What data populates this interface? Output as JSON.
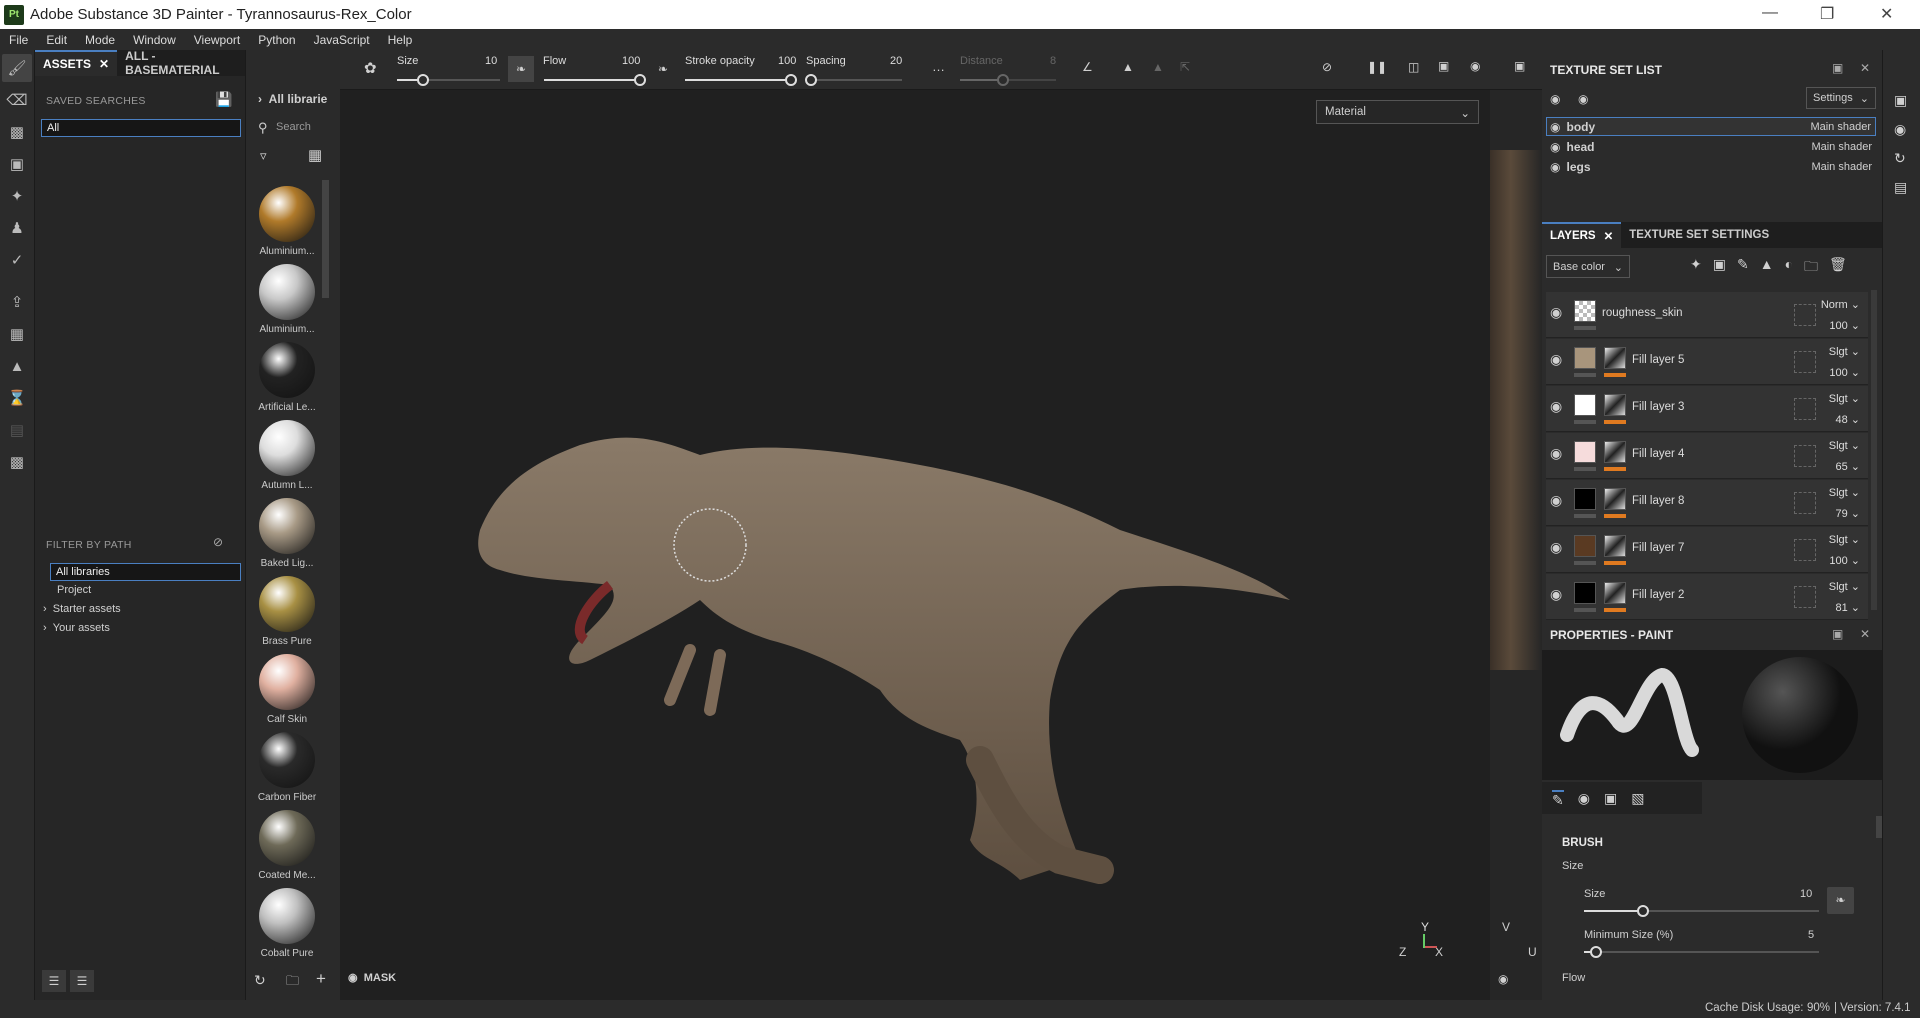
{
  "window": {
    "title": "Adobe Substance 3D Painter - Tyrannosaurus-Rex_Color",
    "app_badge": "Pt"
  },
  "menu": [
    "File",
    "Edit",
    "Mode",
    "Window",
    "Viewport",
    "Python",
    "JavaScript",
    "Help"
  ],
  "assets": {
    "tab_assets": "ASSETS",
    "tab_basematerial": "ALL - BASEMATERIAL",
    "saved_searches": "SAVED SEARCHES",
    "search_value": "All",
    "filter_by_path": "FILTER BY PATH",
    "paths": [
      "All libraries",
      "Project",
      "Starter assets",
      "Your assets"
    ],
    "breadcrumb": "All librarie",
    "search_placeholder": "Search"
  },
  "materials": [
    {
      "name": "Aluminium...",
      "color": "#b07a2a"
    },
    {
      "name": "Aluminium...",
      "color": "#c8c8c8"
    },
    {
      "name": "Artificial Le...",
      "color": "#222"
    },
    {
      "name": "Autumn L...",
      "color": "#ddd"
    },
    {
      "name": "Baked Lig...",
      "color": "#a89a86"
    },
    {
      "name": "Brass Pure",
      "color": "#a89044"
    },
    {
      "name": "Calf Skin",
      "color": "#e0b0a0"
    },
    {
      "name": "Carbon Fiber",
      "color": "#2a2a2a"
    },
    {
      "name": "Coated Me...",
      "color": "#6e6a58"
    },
    {
      "name": "Cobalt Pure",
      "color": "#c0c0c0"
    }
  ],
  "toolbar": {
    "size_label": "Size",
    "size": 10,
    "flow_label": "Flow",
    "flow": 100,
    "stroke_opacity_label": "Stroke opacity",
    "stroke_opacity": 100,
    "spacing_label": "Spacing",
    "spacing": 20,
    "distance_label": "Distance",
    "distance": 8
  },
  "viewport": {
    "mode": "Material",
    "mask_label": "MASK",
    "axis_y": "Y",
    "axis_z": "Z",
    "axis_x": "X",
    "uv_v": "V",
    "uv_u": "U"
  },
  "texture_set_list": {
    "title": "TEXTURE SET LIST",
    "settings": "Settings",
    "sets": [
      {
        "name": "body",
        "shader": "Main shader"
      },
      {
        "name": "head",
        "shader": "Main shader"
      },
      {
        "name": "legs",
        "shader": "Main shader"
      }
    ]
  },
  "layers": {
    "tab_layers": "LAYERS",
    "tab_tss": "TEXTURE SET SETTINGS",
    "channel": "Base color",
    "items": [
      {
        "name": "roughness_skin",
        "blend": "Norm",
        "opacity": "100",
        "color": "checker"
      },
      {
        "name": "Fill layer 5",
        "blend": "Slgt",
        "opacity": "100",
        "color": "#a8957c"
      },
      {
        "name": "Fill layer 3",
        "blend": "Slgt",
        "opacity": "48",
        "color": "#ffffff"
      },
      {
        "name": "Fill layer 4",
        "blend": "Slgt",
        "opacity": "65",
        "color": "#f6dcdc"
      },
      {
        "name": "Fill layer 8",
        "blend": "Slgt",
        "opacity": "79",
        "color": "#000000"
      },
      {
        "name": "Fill layer 7",
        "blend": "Slgt",
        "opacity": "100",
        "color": "#5a3a22"
      },
      {
        "name": "Fill layer 2",
        "blend": "Slgt",
        "opacity": "81",
        "color": "#000000"
      }
    ]
  },
  "properties": {
    "title": "PROPERTIES - PAINT",
    "section": "BRUSH",
    "group_size": "Size",
    "size_label": "Size",
    "size": 10,
    "min_size_label": "Minimum Size (%)",
    "min_size": 5,
    "flow_label": "Flow"
  },
  "status": {
    "cache_label": "Cache Disk Usage:",
    "cache": "90%",
    "version": "| Version: 7.4.1"
  },
  "colors": {
    "accent": "#4a7fc1",
    "mask_orange": "#e07a20"
  }
}
